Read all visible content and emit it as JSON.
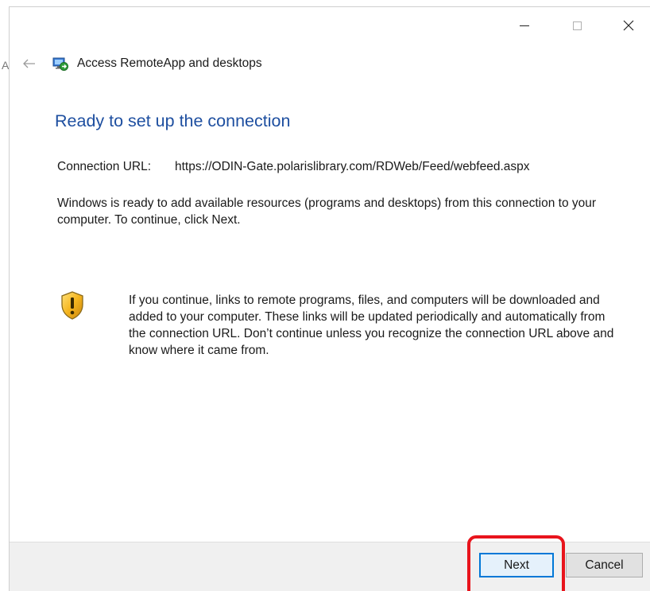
{
  "background": {
    "partial_letter": "A"
  },
  "window": {
    "title": "Access RemoteApp and desktops",
    "icons": {
      "back": "back-arrow-icon",
      "app": "remoteapp-icon",
      "minimize": "minimize-icon",
      "maximize": "maximize-icon",
      "close": "close-icon",
      "shield": "shield-warning-icon"
    }
  },
  "content": {
    "heading": "Ready to set up the connection",
    "url_label": "Connection URL:",
    "url_value": "https://ODIN-Gate.polarislibrary.com/RDWeb/Feed/webfeed.aspx",
    "description": "Windows is ready to add available resources (programs and desktops) from this connection to your computer. To continue, click Next.",
    "warning": "If you continue, links to remote programs, files, and computers will be downloaded and added to your computer.  These links will be updated periodically and automatically from the connection URL. Don’t continue unless you recognize the connection URL above and know where it came from."
  },
  "buttons": {
    "next": "Next",
    "cancel": "Cancel"
  },
  "colors": {
    "heading": "#1e4fa0",
    "highlight": "#e8141c",
    "primary_border": "#0078d7"
  }
}
